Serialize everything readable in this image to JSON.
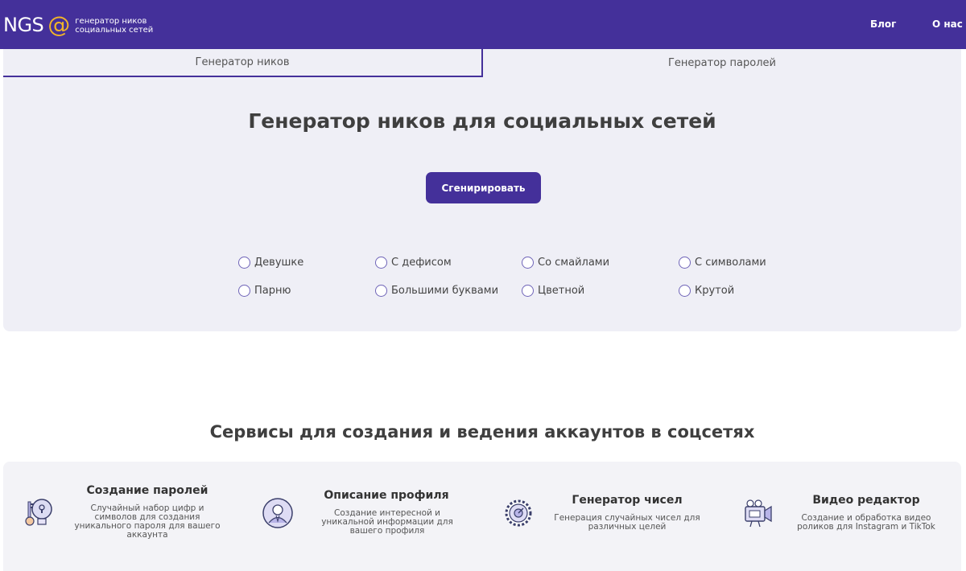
{
  "header": {
    "logo_text": "NGS",
    "logo_at": "@",
    "tagline_line1": "генератор ников",
    "tagline_line2": "социальных сетей",
    "nav": [
      "Блог",
      "О нас"
    ]
  },
  "tabs": [
    "Генератор ников",
    "Генератор паролей"
  ],
  "generator": {
    "title": "Генератор ников для социальных сетей",
    "button": "Сгенирировать",
    "options": [
      "Девушке",
      "С дефисом",
      "Со смайлами",
      "С символами",
      "Парню",
      "Большими буквами",
      "Цветной",
      "Крутой"
    ]
  },
  "services": {
    "title": "Сервисы для создания и ведения аккаунтов в соцсетях",
    "items": [
      {
        "title": "Создание паролей",
        "desc_lines": [
          "Случайный набор цифр и",
          "символов для создания",
          "уникального пароля для вашего",
          "аккаунта"
        ],
        "icon": "key-lock-icon"
      },
      {
        "title": "Описание профиля",
        "desc_lines": [
          "Создание интересной и",
          "уникальной информации для",
          "вашего профиля"
        ],
        "icon": "profile-avatar-icon"
      },
      {
        "title": "Генератор чисел",
        "desc_lines": [
          "Генерация случайных чисел для",
          "различных целей"
        ],
        "icon": "gear-numbers-icon"
      },
      {
        "title": "Видео редактор",
        "desc_lines": [
          "Создание и обработка видео",
          "роликов для Instagram и TikTok"
        ],
        "icon": "video-camera-icon"
      }
    ]
  },
  "colors": {
    "brand": "#44309a",
    "accent": "#f0b429",
    "panel": "#efeff6"
  }
}
